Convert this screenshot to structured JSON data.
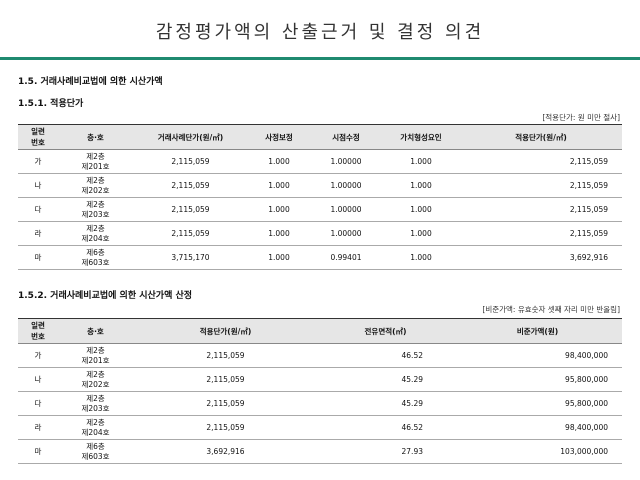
{
  "header": {
    "title": "감정평가액의 산출근거 및 결정 의견",
    "accent_color": "#1f8a70"
  },
  "section": {
    "h1": "1.5. 거래사례비교법에 의한 시산가액",
    "h2": "1.5.1. 적용단가",
    "note1": "[적용단가: 원 미만 절사]",
    "h3": "1.5.2. 거래사례비교법에 의한 시산가액 산정",
    "note2": "[비준가액: 유효숫자 셋째 자리 미만 반올림]"
  },
  "table1": {
    "headers": [
      "일련\n번호",
      "층·호",
      "거래사례단가(원/㎡)",
      "사정보정",
      "시점수정",
      "가치형성요인",
      "적용단가(원/㎡)"
    ],
    "rows": [
      {
        "no": "가",
        "floor": "제2층",
        "unit": "제201호",
        "price": "2,115,059",
        "adj": "1.000",
        "time": "1.00000",
        "value": "1.000",
        "applied": "2,115,059"
      },
      {
        "no": "나",
        "floor": "제2층",
        "unit": "제202호",
        "price": "2,115,059",
        "adj": "1.000",
        "time": "1.00000",
        "value": "1.000",
        "applied": "2,115,059"
      },
      {
        "no": "다",
        "floor": "제2층",
        "unit": "제203호",
        "price": "2,115,059",
        "adj": "1.000",
        "time": "1.00000",
        "value": "1.000",
        "applied": "2,115,059"
      },
      {
        "no": "라",
        "floor": "제2층",
        "unit": "제204호",
        "price": "2,115,059",
        "adj": "1.000",
        "time": "1.00000",
        "value": "1.000",
        "applied": "2,115,059"
      },
      {
        "no": "마",
        "floor": "제6층",
        "unit": "제603호",
        "price": "3,715,170",
        "adj": "1.000",
        "time": "0.99401",
        "value": "1.000",
        "applied": "3,692,916"
      }
    ]
  },
  "table2": {
    "headers": [
      "일련\n번호",
      "층·호",
      "적용단가(원/㎡)",
      "전유면적(㎡)",
      "비준가액(원)"
    ],
    "rows": [
      {
        "no": "가",
        "floor": "제2층",
        "unit": "제201호",
        "applied": "2,115,059",
        "area": "46.52",
        "total": "98,400,000"
      },
      {
        "no": "나",
        "floor": "제2층",
        "unit": "제202호",
        "applied": "2,115,059",
        "area": "45.29",
        "total": "95,800,000"
      },
      {
        "no": "다",
        "floor": "제2층",
        "unit": "제203호",
        "applied": "2,115,059",
        "area": "45.29",
        "total": "95,800,000"
      },
      {
        "no": "라",
        "floor": "제2층",
        "unit": "제204호",
        "applied": "2,115,059",
        "area": "46.52",
        "total": "98,400,000"
      },
      {
        "no": "마",
        "floor": "제6층",
        "unit": "제603호",
        "applied": "3,692,916",
        "area": "27.93",
        "total": "103,000,000"
      }
    ]
  }
}
